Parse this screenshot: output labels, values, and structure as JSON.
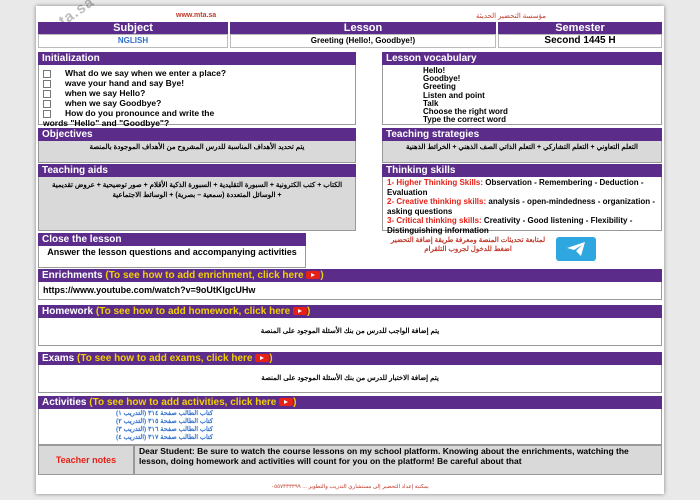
{
  "site": "www.mta.sa",
  "org": "مؤسسة التحضير الحديثة",
  "header": {
    "subject_label": "Subject",
    "lesson_label": "Lesson",
    "semester_label": "Semester",
    "subject_value": "NGLISH",
    "lesson_value": "Greeting (Hello!, Goodbye!)",
    "semester_value": "Second 1445 H"
  },
  "initialization": {
    "title": "Initialization",
    "items": [
      "What do we say when we enter a place?",
      "wave your hand and say Bye!",
      "when we say Hello?",
      "when we say Goodbye?",
      "How do you pronounce and write the"
    ],
    "item_tail": "words \"Hello\" and \"Goodbye\"?"
  },
  "vocabulary": {
    "title": "Lesson vocabulary",
    "items": [
      "Hello!",
      "Goodbye!",
      "Greeting",
      "Listen and point",
      "Talk",
      "Choose the right word",
      "Type the correct word"
    ]
  },
  "objectives": {
    "title": "Objectives",
    "text": "يتم تحديد الأهداف المناسبة للدرس المشروح من الأهداف الموجودة بالمنصة"
  },
  "strategies": {
    "title": "Teaching strategies",
    "text": "التعلم التعاوني + التعلم التشاركي + التعلم الذاتي الصف الذهني + الخرائط الذهنية"
  },
  "aids": {
    "title": "Teaching aids",
    "text": "الكتاب + كتب الكترونية + السبورة التقليدية + السبورة الذكية الأقلام + صور توضيحية + عروض تقديمية + الوسائل المتعددة (سمعية – بصرية) + الوسائط الاجتماعية"
  },
  "thinking": {
    "title": "Thinking skills",
    "higher_label": "1- Higher Thinking Skills:",
    "higher_text": " Observation - Remembering - Deduction - Evaluation",
    "creative_label": "2- Creative thinking skills:",
    "creative_text": " analysis - open-mindedness - organization - asking questions",
    "critical_label": "3- Critical thinking skills:",
    "critical_text": " Creativity - Good listening - Flexibility - Distinguishing information"
  },
  "close": {
    "title": "Close the lesson",
    "text": "Answer the lesson questions and accompanying activities"
  },
  "telegram": {
    "icon": "telegram-icon",
    "text": "لمتابعة تحديثات المنصة ومعرفة طريقة إضافة التحضير اضغط للدخول لجروب التلقرام"
  },
  "enrichments": {
    "title": "Enrichments",
    "hint": "(To see how to add enrichment, click here",
    "url": "https://www.youtube.com/watch?v=9oUtKlgcUHw"
  },
  "homework": {
    "title": "Homework",
    "hint": "(To see how to add homework, click here",
    "text": "يتم إضافة الواجب للدرس من بنك الأسئلة الموجود على المنصة"
  },
  "exams": {
    "title": "Exams",
    "hint": "(To see how to add exams, click here",
    "text": "يتم إضافة الاختبار للدرس من بنك الأسئلة الموجود على المنصة"
  },
  "activities": {
    "title": "Activities",
    "hint": "(To see how to add activities, click here",
    "items": [
      "كتاب الطالب صفحة ٣١٤ (التدريب ١)",
      "كتاب الطالب صفحة ٣١٥ (التدريب ٢)",
      "كتاب الطالب صفحة ٣١٦ (التدريب ٣)",
      "كتاب الطالب صفحة ٣١٧ (التدريب ٤)"
    ]
  },
  "teacher_notes": {
    "label": "Teacher notes",
    "text": "Dear Student: Be sure to watch the course lessons on my school platform. Knowing about the enrichments, watching the lesson, doing homework and activities will count for you on the platform! Be careful about that"
  },
  "footer": "بمكتبة إعداد التحضير إلى مستشاري التدريب والتطوير ... ٠٥٥٧٣٣٣٣٩٩",
  "watermark": "mta.sa",
  "colors": {
    "header": "#5b2c8a",
    "hint": "#f5d000",
    "accent_red": "#e62117",
    "telegram": "#2ea6df"
  }
}
